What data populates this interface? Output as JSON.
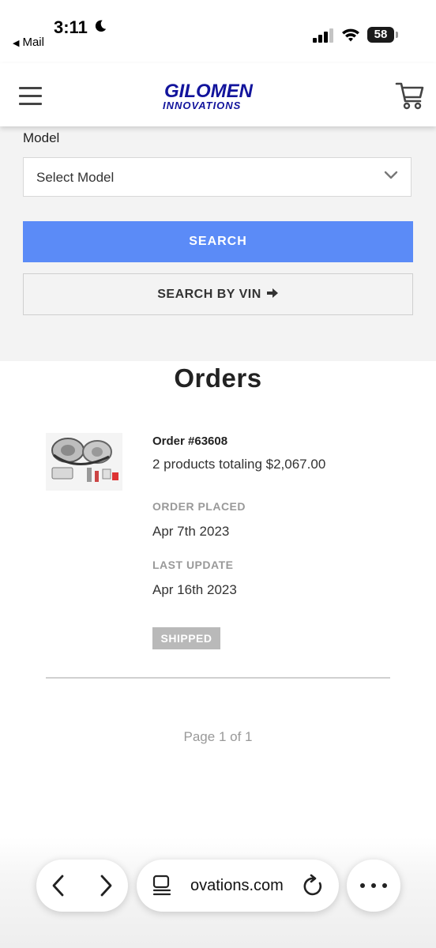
{
  "status_bar": {
    "time": "3:11",
    "back_app": "Mail",
    "battery": "58"
  },
  "header": {
    "logo_line1": "GILOMEN",
    "logo_line2": "INNOVATIONS",
    "brand_color": "#12149c"
  },
  "search": {
    "model_label": "Model",
    "model_select_value": "Select Model",
    "search_button": "SEARCH",
    "vin_button": "SEARCH BY VIN",
    "search_button_color": "#5b8bf7"
  },
  "orders": {
    "title": "Orders",
    "items": [
      {
        "order_number": "Order #63608",
        "summary": "2 products totaling $2,067.00",
        "placed_label": "ORDER PLACED",
        "placed_date": "Apr 7th 2023",
        "update_label": "LAST UPDATE",
        "update_date": "Apr 16th 2023",
        "status": "SHIPPED"
      }
    ],
    "pagination": "Page 1 of 1"
  },
  "browser": {
    "url": "ovations.com"
  }
}
